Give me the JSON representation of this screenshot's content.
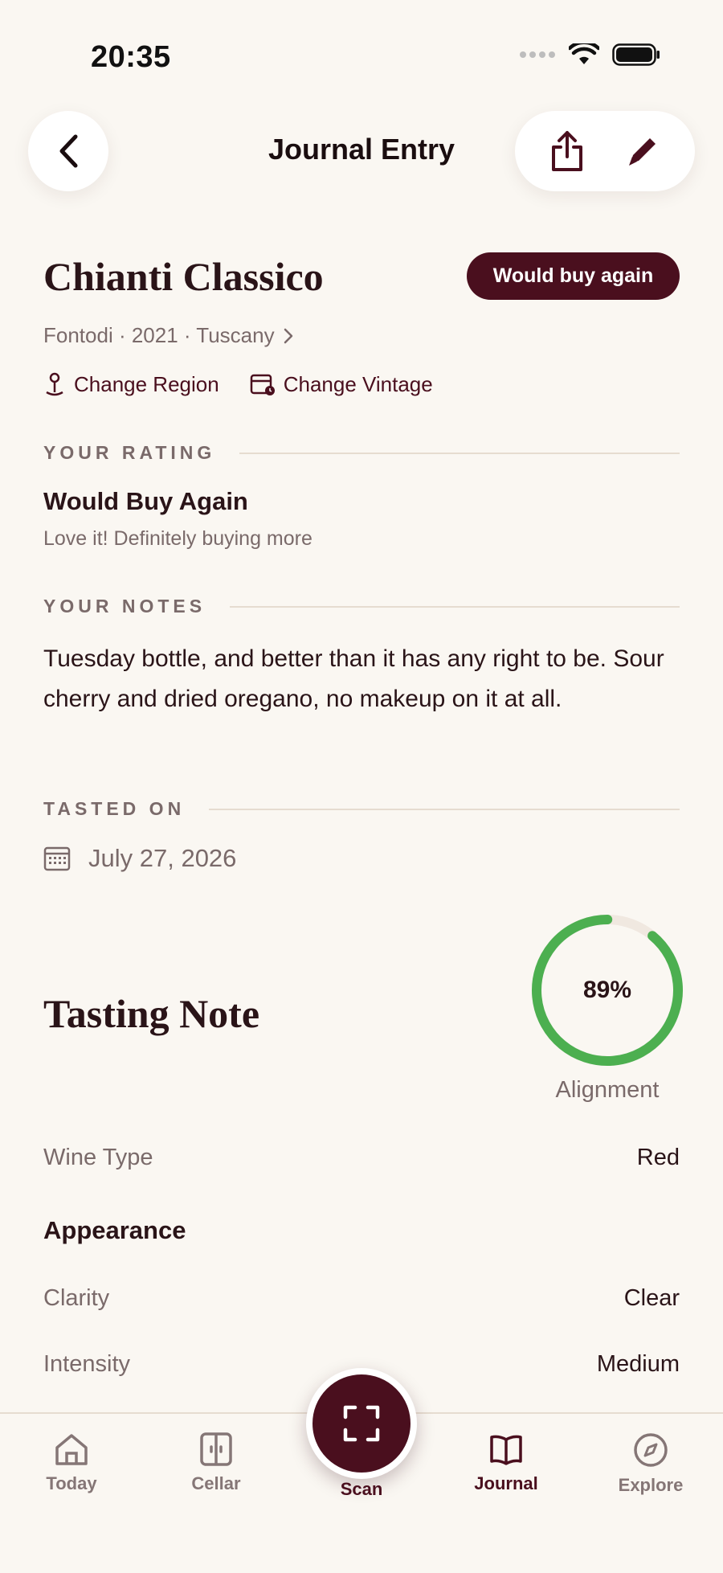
{
  "status_bar": {
    "time": "20:35"
  },
  "nav": {
    "title": "Journal Entry"
  },
  "wine": {
    "name": "Chianti Classico",
    "badge": "Would buy again",
    "subtitle": "Fontodi · 2021 · Tuscany",
    "change_region": "Change Region",
    "change_vintage": "Change Vintage"
  },
  "rating": {
    "section_label": "YOUR RATING",
    "title": "Would Buy Again",
    "subtitle": "Love it! Definitely buying more"
  },
  "notes": {
    "section_label": "YOUR NOTES",
    "text": "Tuesday bottle, and better than it has any right to be. Sour cherry and dried oregano, no makeup on it at all."
  },
  "tasted": {
    "section_label": "TASTED ON",
    "date": "July 27, 2026"
  },
  "tasting_note": {
    "title": "Tasting Note",
    "alignment_value": "89%",
    "alignment_fraction": 0.89,
    "alignment_label": "Alignment",
    "wine_type_label": "Wine Type",
    "wine_type_value": "Red",
    "appearance_heading": "Appearance",
    "clarity_label": "Clarity",
    "clarity_value": "Clear",
    "intensity_label": "Intensity",
    "intensity_value": "Medium"
  },
  "tabs": [
    {
      "label": "Today",
      "icon": "home-icon"
    },
    {
      "label": "Cellar",
      "icon": "cellar-icon"
    },
    {
      "label": "Scan",
      "icon": "scan-icon"
    },
    {
      "label": "Journal",
      "icon": "book-icon"
    },
    {
      "label": "Explore",
      "icon": "compass-icon"
    }
  ],
  "colors": {
    "accent": "#4A0F1E",
    "background": "#FAF7F2",
    "gauge": "#4CAF50",
    "muted_text": "#7A6A6A"
  }
}
